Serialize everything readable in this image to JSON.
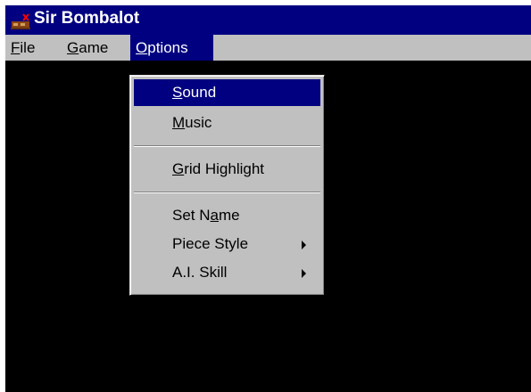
{
  "window": {
    "title": "Sir Bombalot",
    "icon": "app-icon"
  },
  "menubar": {
    "file": {
      "accel": "F",
      "rest": "ile"
    },
    "game": {
      "accel": "G",
      "rest": "ame"
    },
    "options": {
      "accel": "O",
      "rest": "ptions"
    }
  },
  "options_menu": {
    "sound": {
      "accel": "S",
      "rest": "ound"
    },
    "music": {
      "accel": "M",
      "rest": "usic"
    },
    "grid_highlight": {
      "accel": "G",
      "rest": "rid Highlight"
    },
    "set_name": {
      "pre": "Set N",
      "accel": "a",
      "rest": "me"
    },
    "piece_style": {
      "label": "Piece Style"
    },
    "ai_skill": {
      "label": "A.I. Skill"
    },
    "submenu_arrow": "triangle-right-icon"
  },
  "colors": {
    "titlebar": "#000080",
    "highlight": "#000080",
    "face": "#c0c0c0",
    "canvas": "#000000"
  }
}
